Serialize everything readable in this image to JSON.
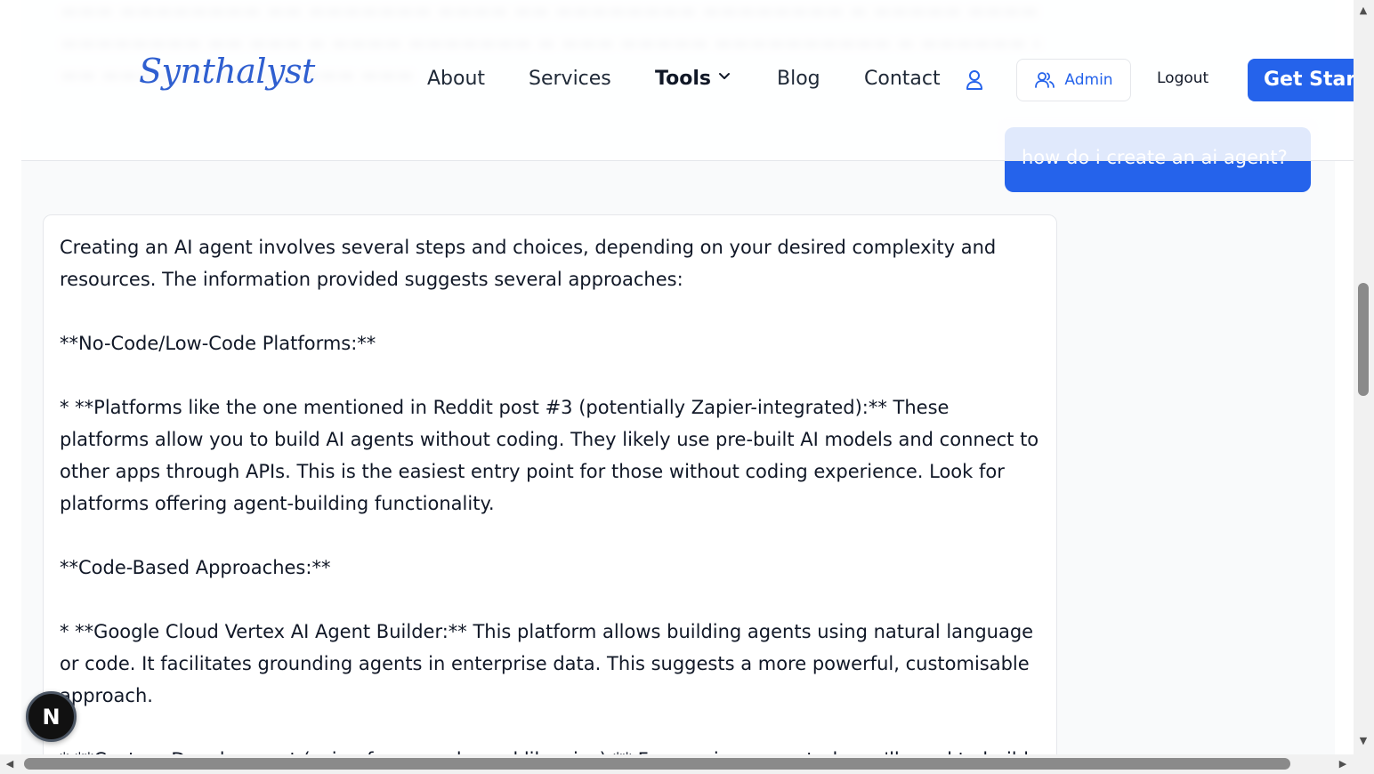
{
  "header": {
    "logo": "Synthalyst",
    "nav": {
      "about": "About",
      "services": "Services",
      "tools": "Tools",
      "blog": "Blog",
      "contact": "Contact"
    },
    "admin_label": "Admin",
    "logout_label": "Logout",
    "cta_label": "Get Start"
  },
  "chat": {
    "user_message": "how do i create an ai agent?",
    "assistant_paragraphs": [
      "Creating an AI agent involves several steps and choices, depending on your desired complexity and resources.  The information provided suggests several approaches:",
      "",
      "**No-Code/Low-Code Platforms:**",
      "",
      "* **Platforms like the one mentioned in Reddit post #3 (potentially Zapier-integrated):**  These platforms allow you to build AI agents without coding.  They likely use pre-built AI models and connect to other apps through APIs. This is the easiest entry point for those without coding experience.  Look for platforms offering agent-building functionality.",
      "",
      "**Code-Based Approaches:**",
      "",
      "* **Google Cloud Vertex AI Agent Builder:** This platform allows building agents using natural language or code.  It facilitates grounding agents in enterprise data.  This suggests a more powerful, customisable approach.",
      "",
      "* **Custom Development (using frameworks and libraries):** For maximum control, you'll need to build"
    ]
  },
  "badge": {
    "label": "N"
  },
  "colors": {
    "accent": "#2563eb",
    "text": "#111827",
    "border": "#e5e7eb"
  },
  "icons": [
    "chevron-down-icon",
    "user-icon",
    "users-icon"
  ]
}
